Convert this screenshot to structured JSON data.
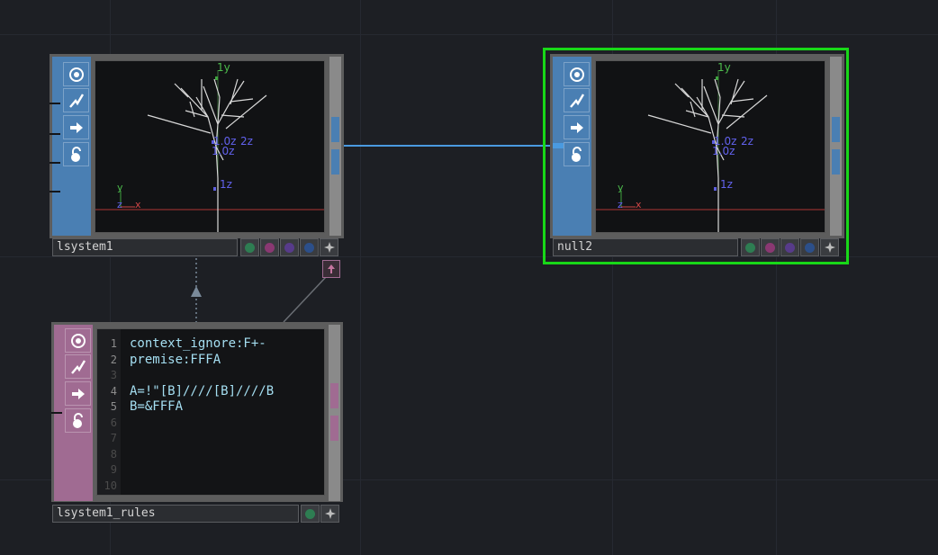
{
  "nodes": {
    "lsystem1": {
      "name": "lsystem1"
    },
    "null2": {
      "name": "null2"
    },
    "rules": {
      "name": "lsystem1_rules",
      "lines": [
        {
          "num": "1",
          "text": "context_ignore:F+-"
        },
        {
          "num": "2",
          "text": "premise:FFFA"
        },
        {
          "num": "3",
          "text": ""
        },
        {
          "num": "4",
          "text": "A=!\"[B]////[B]////B"
        },
        {
          "num": "5",
          "text": "B=&FFFA"
        },
        {
          "num": "6",
          "text": ""
        },
        {
          "num": "7",
          "text": ""
        },
        {
          "num": "8",
          "text": ""
        },
        {
          "num": "9",
          "text": ""
        },
        {
          "num": "10",
          "text": ""
        }
      ]
    }
  },
  "viewer_labels": {
    "y_top": "1y",
    "l1": "1.0z",
    "l2": "1.0z",
    "l3": "2z",
    "l4": "1z",
    "axis_y": "y",
    "axis_z": "z",
    "axis_x": "x"
  },
  "colors": {
    "background": "#1d1f24",
    "sop_strip": "#4a7fb3",
    "dat_strip": "#a06b92",
    "selected_outline": "#18d818",
    "wire": "#4a9ae0",
    "code_text": "#a5dff2"
  },
  "icons": {
    "strip_buttons": [
      "viewer-icon",
      "bypass-icon",
      "display-icon",
      "lock-icon"
    ],
    "flags_sop": [
      "green-flag",
      "pink-flag",
      "purple-flag",
      "blue-flag",
      "pin-icon"
    ],
    "flags_dat": [
      "green-flag",
      "pin-icon"
    ]
  }
}
